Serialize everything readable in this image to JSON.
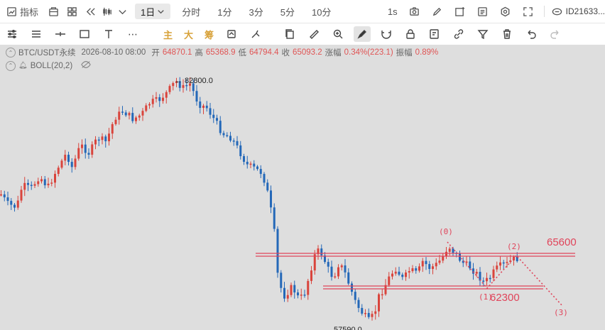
{
  "topbar": {
    "indicator_label": "指标",
    "timeframe_selected": "1日",
    "timeframes": [
      "分时",
      "1分",
      "3分",
      "5分",
      "10分"
    ],
    "interval": "1s",
    "user_id": "ID21633..."
  },
  "toolbar": {
    "chinese_tools": [
      "主",
      "大",
      "筹"
    ]
  },
  "info": {
    "symbol": "BTC/USDT永续",
    "datetime": "2026-08-10 08:00",
    "open_label": "开",
    "open": "64870.1",
    "high_label": "高",
    "high": "65368.9",
    "low_label": "低",
    "low": "64794.4",
    "close_label": "收",
    "close": "65093.2",
    "change_label": "涨幅",
    "change": "0.34%(223.1)",
    "amp_label": "振幅",
    "amp": "0.89%"
  },
  "indicator": {
    "label": "BOLL(20,2)"
  },
  "chart_data": {
    "type": "candlestick",
    "colors": {
      "up": "#d9443c",
      "down": "#2468b8",
      "annotation": "#e0445a",
      "background": "#dedede"
    },
    "max_label": "← 82800.0",
    "min_label": "57590.0",
    "resistance_label": "65600",
    "support_label": "62300",
    "waves": [
      "(0)",
      "(1)",
      "(2)",
      "(3)"
    ]
  }
}
